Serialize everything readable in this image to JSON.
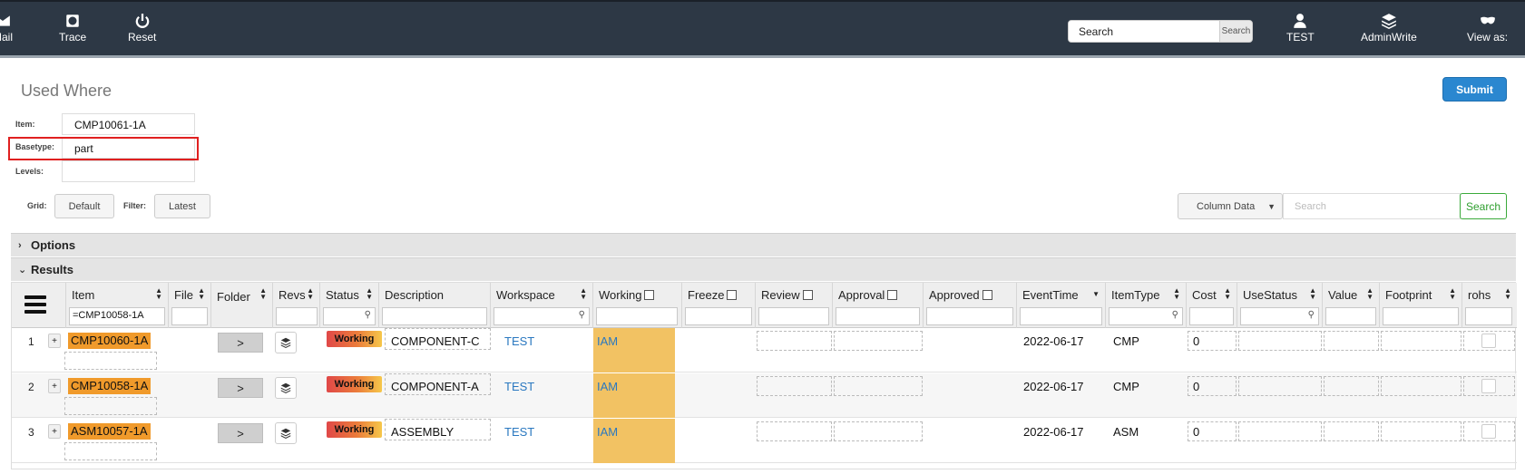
{
  "topbar": {
    "nav_left": [
      {
        "label": "Mail",
        "icon": "mail-icon"
      },
      {
        "label": "Trace",
        "icon": "trace-icon"
      },
      {
        "label": "Reset",
        "icon": "power-icon"
      }
    ],
    "search_placeholder": "Search",
    "search_button": "Search",
    "nav_right": [
      {
        "label": "TEST",
        "icon": "user-icon"
      },
      {
        "label": "AdminWrite",
        "icon": "layers-icon"
      },
      {
        "label": "View as:",
        "icon": "mask-icon"
      }
    ]
  },
  "page": {
    "title": "Used Where",
    "submit_label": "Submit"
  },
  "form": {
    "item_label": "Item:",
    "item_value": "CMP10061-1A",
    "basetype_label": "Basetype:",
    "basetype_value": "part",
    "levels_label": "Levels:",
    "levels_value": ""
  },
  "controls": {
    "grid_label": "Grid:",
    "grid_value": "Default",
    "filter_label": "Filter:",
    "filter_value": "Latest",
    "column_select": "Column Data",
    "column_search_placeholder": "Search",
    "column_search_button": "Search"
  },
  "sections": {
    "options": "Options",
    "results": "Results"
  },
  "grid": {
    "columns": [
      "Item",
      "File",
      "Folder",
      "Revs",
      "Status",
      "Description",
      "Workspace",
      "Working",
      "Freeze",
      "Review",
      "Approval",
      "Approved",
      "EventTime",
      "ItemType",
      "Cost",
      "UseStatus",
      "Value",
      "Footprint",
      "rohs"
    ],
    "item_filter": "=CMP10058-1A",
    "rows": [
      {
        "num": "1",
        "item": "CMP10060-1A",
        "folder": ">",
        "status": "Working",
        "description": "COMPONENT-C",
        "workspace": "TEST",
        "working": "IAM",
        "eventtime": "2022-06-17",
        "itemtype": "CMP",
        "cost": "0"
      },
      {
        "num": "2",
        "item": "CMP10058-1A",
        "folder": ">",
        "status": "Working",
        "description": "COMPONENT-A",
        "workspace": "TEST",
        "working": "IAM",
        "eventtime": "2022-06-17",
        "itemtype": "CMP",
        "cost": "0"
      },
      {
        "num": "3",
        "item": "ASM10057-1A",
        "folder": ">",
        "status": "Working",
        "description": "ASSEMBLY",
        "workspace": "TEST",
        "working": "IAM",
        "eventtime": "2022-06-17",
        "itemtype": "ASM",
        "cost": "0"
      }
    ]
  },
  "colors": {
    "topbar": "#2d3845",
    "accent": "#2a87d0",
    "item_badge": "#f09a2b",
    "working_cell": "#f2c263"
  }
}
